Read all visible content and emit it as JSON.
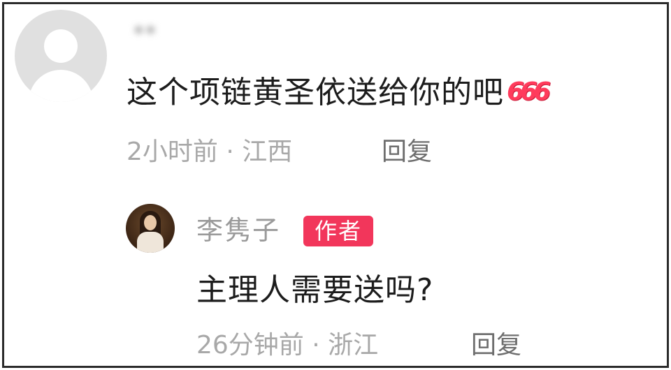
{
  "comments": [
    {
      "username": "**",
      "text": "这个项链黄圣依送给你的吧",
      "emoji": "666",
      "meta": "2小时前 · 江西",
      "reply_label": "回复"
    }
  ],
  "reply": {
    "author_name": "李隽子",
    "badge": "作者",
    "text": "主理人需要送吗?",
    "meta": "26分钟前 · 浙江",
    "reply_label": "回复"
  },
  "colors": {
    "text": "#1c1c1c",
    "meta": "#a8a8a8",
    "reply": "#6e6e6e",
    "badge": "#f2365b",
    "emoji": "#ff3b5c"
  },
  "icons": {
    "default_avatar": "default-avatar-icon",
    "author_avatar": "author-avatar"
  }
}
